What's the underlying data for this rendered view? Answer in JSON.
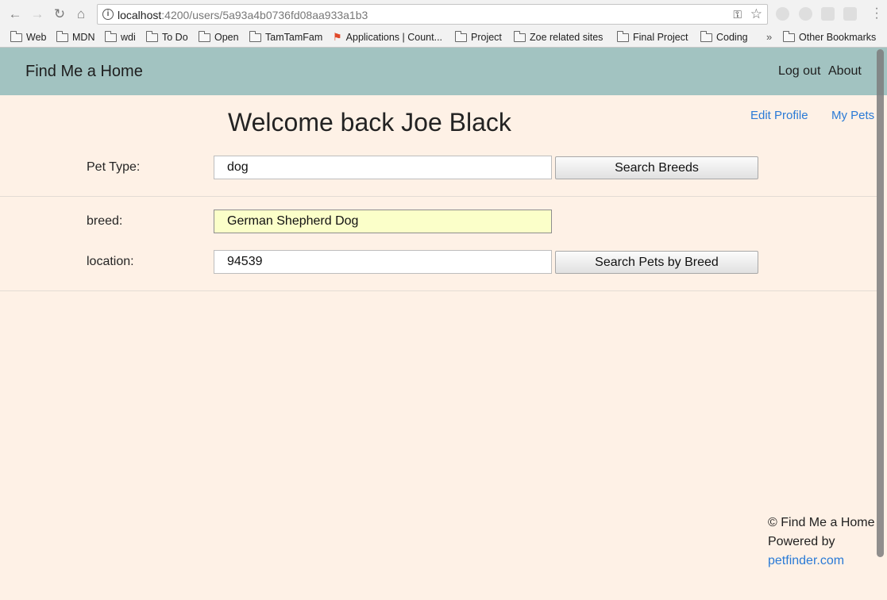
{
  "browser": {
    "url_host": "localhost",
    "url_rest": ":4200/users/5a93a4b0736fd08aa933a1b3",
    "bookmarks": [
      {
        "label": "Web",
        "icon": "folder-icon"
      },
      {
        "label": "MDN",
        "icon": "folder-icon"
      },
      {
        "label": "wdi",
        "icon": "folder-icon"
      },
      {
        "label": "To Do",
        "icon": "folder-icon"
      },
      {
        "label": "Open",
        "icon": "folder-icon"
      },
      {
        "label": "TamTamFam",
        "icon": "folder-icon"
      },
      {
        "label": "Applications | Count...",
        "icon": "flag-icon"
      },
      {
        "label": "Project",
        "icon": "folder-icon"
      },
      {
        "label": "Zoe related sites",
        "icon": "folder-icon"
      },
      {
        "label": "Final Project",
        "icon": "folder-icon"
      },
      {
        "label": "Coding",
        "icon": "folder-icon"
      }
    ],
    "overflow_chevron": "»",
    "other_bookmarks": "Other Bookmarks"
  },
  "app": {
    "brand": "Find Me a Home",
    "logout": "Log out",
    "about": "About",
    "header_color": "#a2c3c1",
    "background_color": "#fef1e6"
  },
  "main": {
    "welcome": "Welcome back Joe Black",
    "edit_profile": "Edit Profile",
    "my_pets": "My Pets",
    "pet_type_label": "Pet Type:",
    "pet_type_value": "dog",
    "search_breeds": "Search Breeds",
    "breed_label": "breed:",
    "breed_value": "German Shepherd Dog",
    "location_label": "location:",
    "location_value": "94539",
    "search_pets": "Search Pets by Breed"
  },
  "footer": {
    "copyright": "© Find Me a Home",
    "powered_by": "Powered by",
    "petfinder": "petfinder.com"
  }
}
